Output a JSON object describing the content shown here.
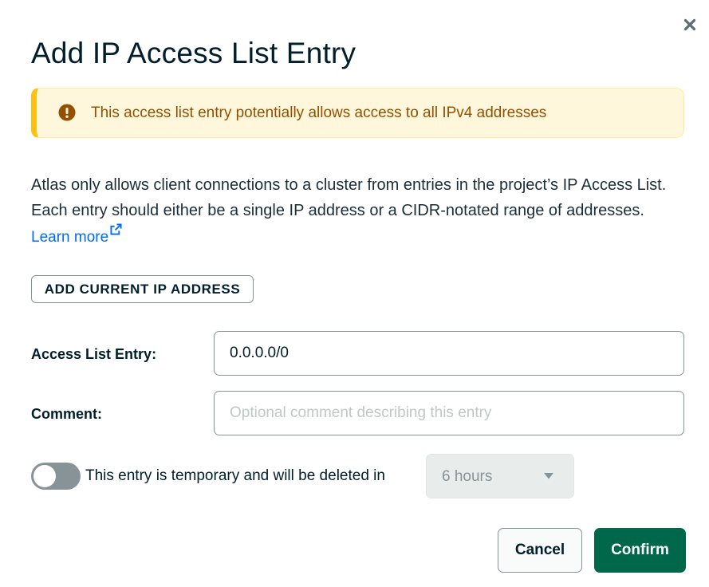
{
  "dialog": {
    "title": "Add IP Access List Entry",
    "close_icon": "close-icon"
  },
  "banner": {
    "icon": "warning-icon",
    "text": "This access list entry potentially allows access to all IPv4 addresses",
    "accent_color": "#ffc010"
  },
  "description": {
    "text": "Atlas only allows client connections to a cluster from entries in the project’s IP Access List. Each entry should either be a single IP address or a CIDR-notated range of addresses.",
    "link_text": "Learn more",
    "link_icon": "external-link-icon"
  },
  "add_current_ip": {
    "label": "ADD CURRENT IP ADDRESS"
  },
  "form": {
    "entry_label": "Access List Entry:",
    "entry_value": "0.0.0.0/0",
    "comment_label": "Comment:",
    "comment_value": "",
    "comment_placeholder": "Optional comment describing this entry"
  },
  "temporary": {
    "toggle_on": false,
    "text": "This entry is temporary and will be deleted in",
    "duration_value": "6 hours",
    "caret_icon": "caret-down-icon"
  },
  "footer": {
    "cancel_label": "Cancel",
    "confirm_label": "Confirm",
    "confirm_color": "#00684a"
  }
}
